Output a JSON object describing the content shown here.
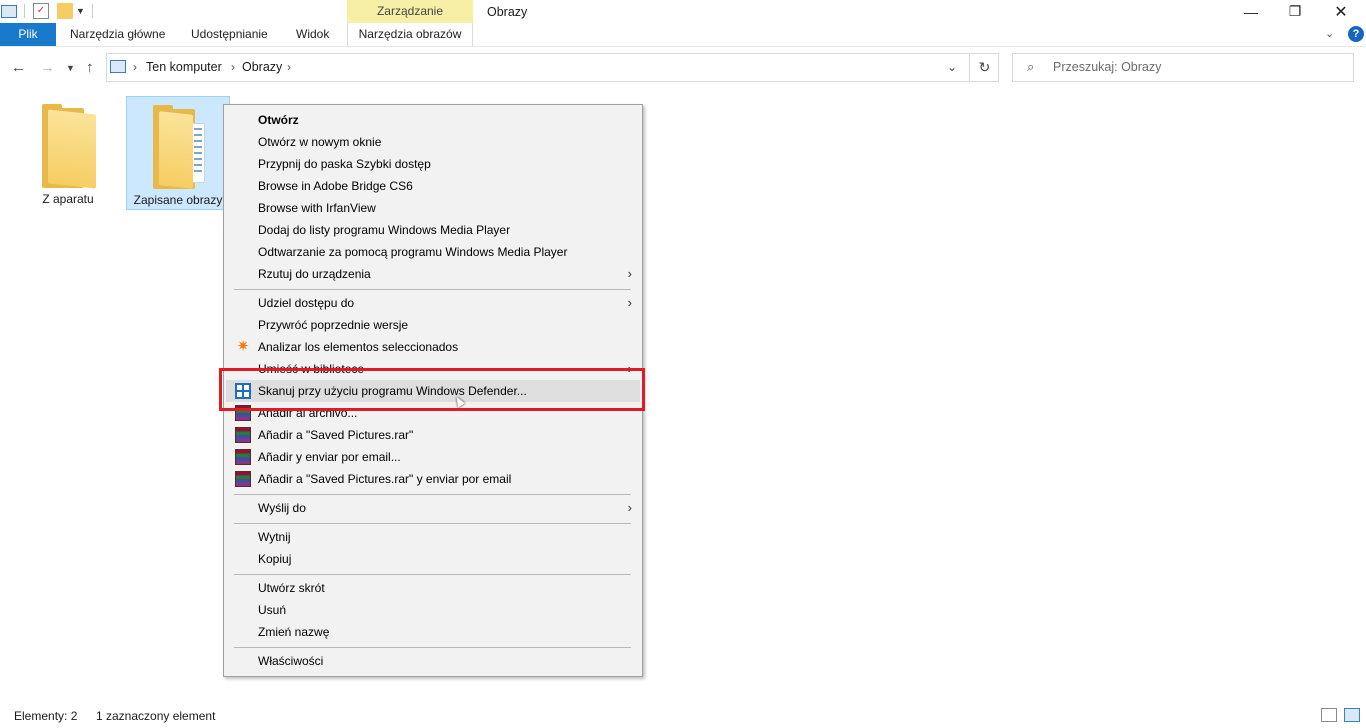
{
  "window": {
    "title": "Obrazy",
    "manage_tab": "Zarządzanie"
  },
  "ribbon": {
    "file_tab": "Plik",
    "tabs": [
      "Narzędzia główne",
      "Udostępnianie",
      "Widok"
    ],
    "picture_tools_tab": "Narzędzia obrazów"
  },
  "address": {
    "crumbs": [
      "Ten komputer",
      "Obrazy"
    ],
    "search_placeholder": "Przeszukaj: Obrazy"
  },
  "files": [
    {
      "name": "Z aparatu",
      "selected": false
    },
    {
      "name": "Zapisane obrazy",
      "selected": true
    }
  ],
  "context_menu": {
    "items": [
      {
        "label": "Otwórz",
        "bold": true
      },
      {
        "label": "Otwórz w nowym oknie"
      },
      {
        "label": "Przypnij do paska Szybki dostęp"
      },
      {
        "label": "Browse in Adobe Bridge CS6"
      },
      {
        "label": "Browse with IrfanView"
      },
      {
        "label": "Dodaj do listy programu Windows Media Player"
      },
      {
        "label": "Odtwarzanie za pomocą programu Windows Media Player"
      },
      {
        "label": "Rzutuj do urządzenia",
        "submenu": true
      },
      {
        "label": "Udziel dostępu do",
        "submenu": true
      },
      {
        "label": "Przywróć poprzednie wersje"
      },
      {
        "label": "Analizar los elementos seleccionados",
        "icon": "avast-icon"
      },
      {
        "label": "Umieść w bibliotece",
        "submenu": true
      },
      {
        "label": "Skanuj przy użyciu programu Windows Defender...",
        "icon": "windows-defender-icon",
        "highlighted": true
      },
      {
        "label": "Añadir al archivo...",
        "icon": "winrar-icon"
      },
      {
        "label": "Añadir a \"Saved Pictures.rar\"",
        "icon": "winrar-icon"
      },
      {
        "label": "Añadir y enviar por email...",
        "icon": "winrar-icon"
      },
      {
        "label": "Añadir a \"Saved Pictures.rar\" y enviar por email",
        "icon": "winrar-icon"
      },
      {
        "label": "Wyślij do",
        "submenu": true
      },
      {
        "label": "Wytnij"
      },
      {
        "label": "Kopiuj"
      },
      {
        "label": "Utwórz skrót"
      },
      {
        "label": "Usuń"
      },
      {
        "label": "Zmień nazwę"
      },
      {
        "label": "Właściwości"
      }
    ]
  },
  "status": {
    "count": "Elementy: 2",
    "selection": "1 zaznaczony element"
  },
  "colors": {
    "accent": "#1979ca",
    "manage_tab": "#f8efa6",
    "selection": "#cce8ff",
    "highlight_box": "#e01b24"
  }
}
